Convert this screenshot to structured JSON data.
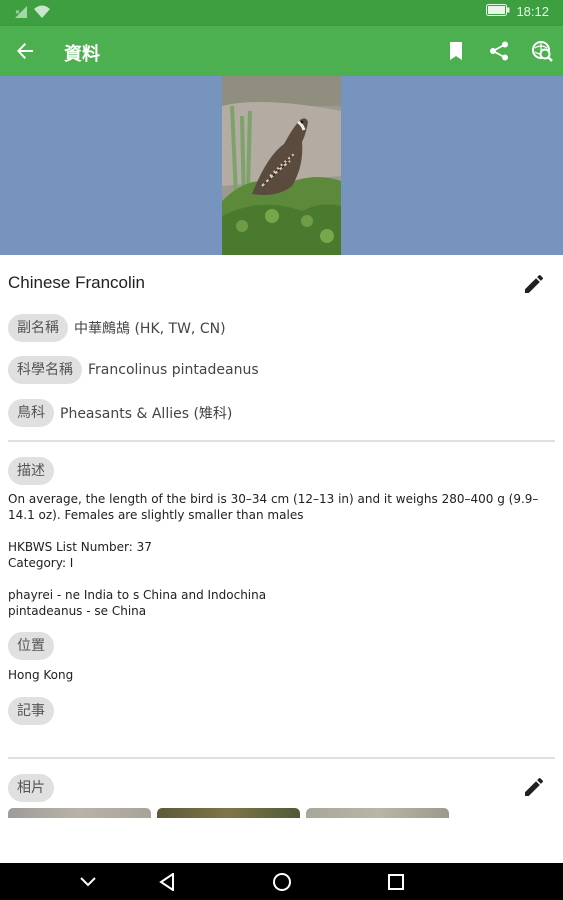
{
  "status_bar": {
    "time": "18:12",
    "icons": [
      "sim-signal-icon",
      "wifi-icon",
      "battery-icon"
    ]
  },
  "app_bar": {
    "title": "資料",
    "actions": [
      "bookmark-icon",
      "share-icon",
      "search-web-icon"
    ]
  },
  "bird": {
    "name": "Chinese Francolin",
    "details": [
      {
        "chip": "副名稱",
        "value": "中華鷓鴣 (HK, TW, CN)"
      },
      {
        "chip": "科學名稱",
        "value": "Francolinus pintadeanus"
      },
      {
        "chip": "鳥科",
        "value": "Pheasants & Allies (雉科)"
      }
    ]
  },
  "description": {
    "chip": "描述",
    "lines": [
      "On average, the length of the bird is 30–34 cm (12–13 in) and it weighs 280–400 g (9.9–",
      "14.1 oz). Females are slightly smaller than males",
      "",
      "HKBWS List Number: 37",
      "Category: I",
      "",
      "phayrei - ne India to s China and Indochina",
      "pintadeanus - se China"
    ]
  },
  "location": {
    "chip": "位置",
    "value": "Hong Kong"
  },
  "notes": {
    "chip": "記事"
  },
  "photos": {
    "chip": "相片"
  },
  "colors": {
    "status_bar": "#3d9f40",
    "app_bar": "#4caf50",
    "hero_background": "#7694bd",
    "chip": "#e0e0e0",
    "nav_bar": "#000000"
  }
}
